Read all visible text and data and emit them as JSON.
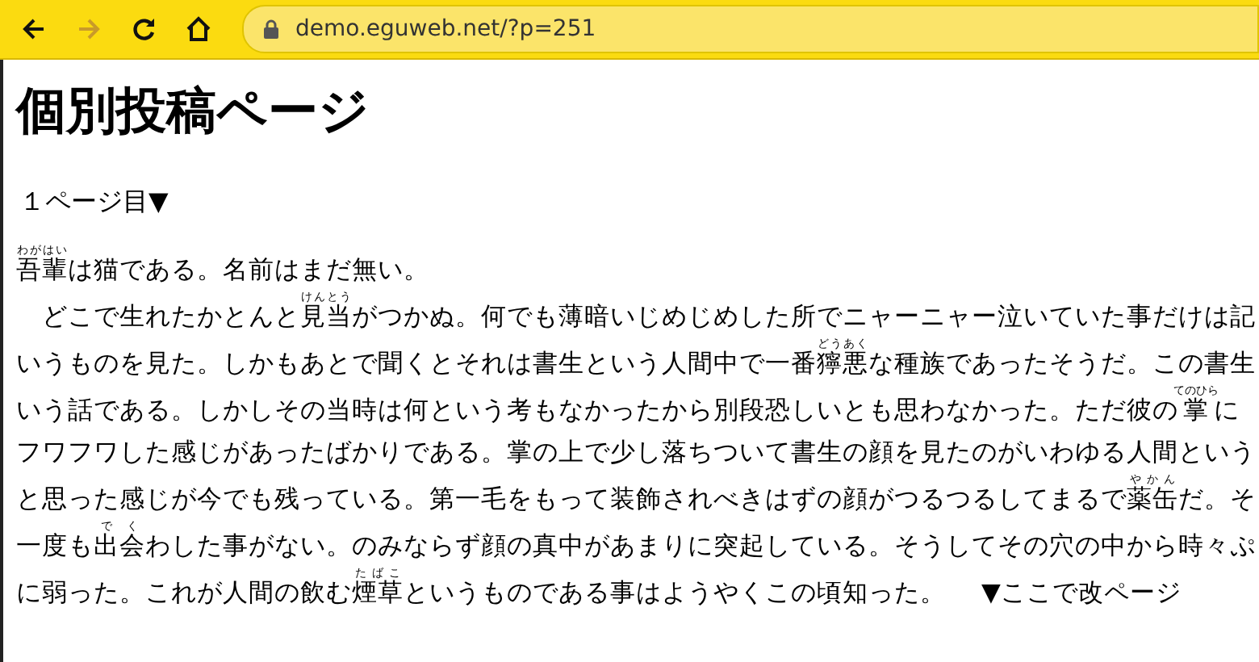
{
  "toolbar": {
    "buttons": [
      {
        "kind": "back",
        "disabled": false
      },
      {
        "kind": "forward",
        "disabled": true
      },
      {
        "kind": "reload",
        "disabled": false
      },
      {
        "kind": "home",
        "disabled": false
      }
    ],
    "url": "demo.eguweb.net/?p=251"
  },
  "heading": "個別投稿ページ",
  "page_label": "１ページ目▼",
  "lines": [
    {
      "segments": [
        {
          "text": "吾輩",
          "ruby": "わがはい"
        },
        {
          "text": "は猫である。名前はまだ無い。"
        }
      ]
    },
    {
      "segments": [
        {
          "text": "　どこで生れたかとんと"
        },
        {
          "text": "見当",
          "ruby": "けんとう"
        },
        {
          "text": "がつかぬ。何でも薄暗いじめじめした所でニャーニャー泣いていた事だけは記"
        }
      ]
    },
    {
      "segments": [
        {
          "text": "いうものを見た。しかもあとで聞くとそれは書生という人間中で一番"
        },
        {
          "text": "獰悪",
          "ruby": "どうあく"
        },
        {
          "text": "な種族であったそうだ。この書生"
        }
      ]
    },
    {
      "segments": [
        {
          "text": "いう話である。しかしその当時は何という考もなかったから別段恐しいとも思わなかった。ただ彼の"
        },
        {
          "text": "掌",
          "ruby": "てのひら"
        },
        {
          "text": "に"
        }
      ]
    },
    {
      "segments": [
        {
          "text": "フワフワした感じがあったばかりである。掌の上で少し落ちついて書生の顔を見たのがいわゆる人間という"
        }
      ]
    },
    {
      "segments": [
        {
          "text": "と思った感じが今でも残っている。第一毛をもって装飾されべきはずの顔がつるつるしてまるで"
        },
        {
          "text": "薬缶",
          "ruby": "やかん"
        },
        {
          "text": "だ。そ"
        }
      ]
    },
    {
      "segments": [
        {
          "text": "一度も"
        },
        {
          "text": "出会",
          "ruby": "でく"
        },
        {
          "text": "わした事がない。のみならず顔の真中があまりに突起している。そうしてその穴の中から時々ぷ"
        }
      ]
    },
    {
      "segments": [
        {
          "text": "に弱った。これが人間の飲む"
        },
        {
          "text": "煙草",
          "ruby": "たばこ"
        },
        {
          "text": "というものである事はようやくこの頃知った。"
        }
      ]
    }
  ],
  "page_break": "▼ここで改ページ"
}
